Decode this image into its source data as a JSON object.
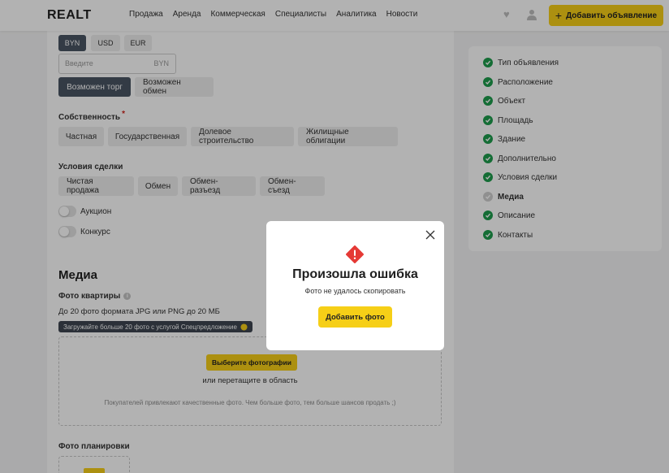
{
  "header": {
    "logo": "REALT",
    "nav": [
      "Продажа",
      "Аренда",
      "Коммерческая",
      "Специалисты",
      "Аналитика",
      "Новости"
    ],
    "add_button": "Добавить объявление"
  },
  "form": {
    "currencies": [
      "BYN",
      "USD",
      "EUR"
    ],
    "active_currency": "BYN",
    "price_placeholder": "Введите",
    "price_currency": "BYN",
    "options": [
      "Возможен торг",
      "Возможен обмен"
    ],
    "ownership_label": "Собственность",
    "ownership_required_mark": "*",
    "ownership_options": [
      "Частная",
      "Государственная",
      "Долевое строительство",
      "Жилищные облигации"
    ],
    "deal_label": "Условия сделки",
    "deal_options": [
      "Чистая продажа",
      "Обмен",
      "Обмен-разъезд",
      "Обмен-съезд"
    ],
    "toggles": [
      "Аукцион",
      "Конкурс"
    ],
    "media_title": "Медиа",
    "photo_label": "Фото квартиры",
    "photo_rule": "До 20 фото формата JPG или PNG до 20 МБ",
    "promo_badge": "Загружайте больше 20 фото с услугой Спецпредложение",
    "choose_photos": "Выберите фотографии",
    "drag_text": "или перетащите в область",
    "hint_text": "Покупателей привлекают качественные фото. Чем больше фото, тем больше шансов продать ;)",
    "plan_label": "Фото планировки"
  },
  "steps": [
    {
      "label": "Тип объявления",
      "status": "done"
    },
    {
      "label": "Расположение",
      "status": "done"
    },
    {
      "label": "Объект",
      "status": "done"
    },
    {
      "label": "Площадь",
      "status": "done"
    },
    {
      "label": "Здание",
      "status": "done"
    },
    {
      "label": "Дополнительно",
      "status": "done"
    },
    {
      "label": "Условия сделки",
      "status": "done"
    },
    {
      "label": "Медиа",
      "status": "current"
    },
    {
      "label": "Описание",
      "status": "done"
    },
    {
      "label": "Контакты",
      "status": "done"
    }
  ],
  "modal": {
    "title": "Произошла ошибка",
    "subtitle": "Фото не удалось скопировать",
    "button": "Добавить фото"
  },
  "colors": {
    "accent": "#f6cf17",
    "active_chip": "#4a5563",
    "step_done": "#1e9c4c",
    "error": "#e53935"
  }
}
